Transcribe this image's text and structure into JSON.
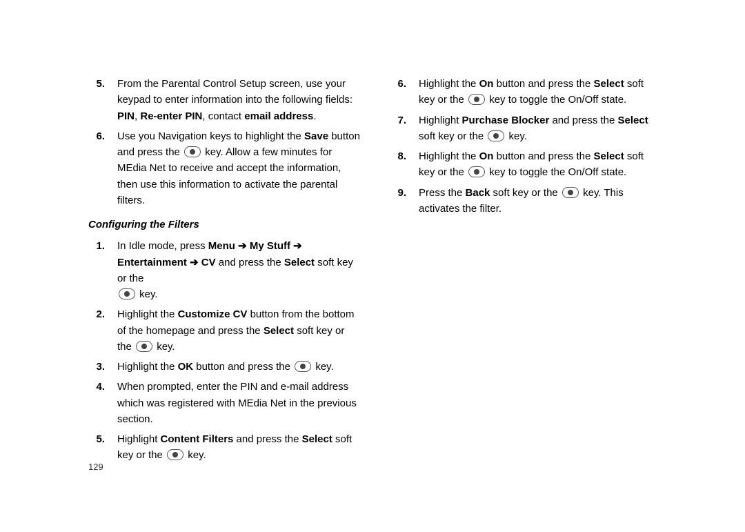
{
  "page_number": "129",
  "left": {
    "pre_items": [
      {
        "num": "5.",
        "parts": [
          {
            "t": "text",
            "v": "From the Parental Control Setup screen, use your keypad to enter information into the following fields: "
          },
          {
            "t": "bold",
            "v": "PIN"
          },
          {
            "t": "text",
            "v": ", "
          },
          {
            "t": "bold",
            "v": "Re-enter PIN"
          },
          {
            "t": "text",
            "v": ", contact "
          },
          {
            "t": "bold",
            "v": "email address"
          },
          {
            "t": "text",
            "v": "."
          }
        ]
      },
      {
        "num": "6.",
        "parts": [
          {
            "t": "text",
            "v": "Use you Navigation keys to highlight the "
          },
          {
            "t": "bold",
            "v": "Save"
          },
          {
            "t": "text",
            "v": " button and press the "
          },
          {
            "t": "key"
          },
          {
            "t": "text",
            "v": " key. Allow a few minutes for MEdia Net to receive and accept the information, then use this information to activate the parental filters."
          }
        ]
      }
    ],
    "heading": "Configuring the Filters",
    "items": [
      {
        "num": "1.",
        "parts": [
          {
            "t": "text",
            "v": "In Idle mode, press "
          },
          {
            "t": "bold",
            "v": "Menu"
          },
          {
            "t": "text",
            "v": " "
          },
          {
            "t": "arrow"
          },
          {
            "t": "text",
            "v": " "
          },
          {
            "t": "bold",
            "v": "My Stuff"
          },
          {
            "t": "text",
            "v": " "
          },
          {
            "t": "arrow"
          },
          {
            "t": "text",
            "v": " "
          },
          {
            "t": "bold",
            "v": "Entertainment"
          },
          {
            "t": "text",
            "v": " "
          },
          {
            "t": "arrow"
          },
          {
            "t": "text",
            "v": " "
          },
          {
            "t": "bold",
            "v": "CV"
          },
          {
            "t": "text",
            "v": " and press the "
          },
          {
            "t": "bold",
            "v": "Select"
          },
          {
            "t": "text",
            "v": " soft key or the "
          },
          {
            "t": "br"
          },
          {
            "t": "key"
          },
          {
            "t": "text",
            "v": " key."
          }
        ]
      },
      {
        "num": "2.",
        "parts": [
          {
            "t": "text",
            "v": "Highlight the "
          },
          {
            "t": "bold",
            "v": "Customize CV"
          },
          {
            "t": "text",
            "v": " button from the bottom of the homepage and press the "
          },
          {
            "t": "bold",
            "v": "Select"
          },
          {
            "t": "text",
            "v": " soft key or the "
          },
          {
            "t": "key"
          },
          {
            "t": "text",
            "v": " key."
          }
        ]
      },
      {
        "num": "3.",
        "parts": [
          {
            "t": "text",
            "v": "Highlight the "
          },
          {
            "t": "bold",
            "v": "OK"
          },
          {
            "t": "text",
            "v": " button and press the "
          },
          {
            "t": "key"
          },
          {
            "t": "text",
            "v": " key."
          }
        ]
      },
      {
        "num": "4.",
        "parts": [
          {
            "t": "text",
            "v": "When prompted, enter the PIN and e-mail address which was registered with MEdia Net in the previous section."
          }
        ]
      },
      {
        "num": "5.",
        "parts": [
          {
            "t": "text",
            "v": "Highlight "
          },
          {
            "t": "bold",
            "v": "Content Filters"
          },
          {
            "t": "text",
            "v": " and press the "
          },
          {
            "t": "bold",
            "v": "Select"
          },
          {
            "t": "text",
            "v": " soft key or the "
          },
          {
            "t": "key"
          },
          {
            "t": "text",
            "v": " key."
          }
        ]
      }
    ]
  },
  "right": {
    "items": [
      {
        "num": "6.",
        "parts": [
          {
            "t": "text",
            "v": "Highlight the "
          },
          {
            "t": "bold",
            "v": "On"
          },
          {
            "t": "text",
            "v": " button and press the "
          },
          {
            "t": "bold",
            "v": "Select"
          },
          {
            "t": "text",
            "v": " soft key or the "
          },
          {
            "t": "key"
          },
          {
            "t": "text",
            "v": " key to toggle the On/Off state."
          }
        ]
      },
      {
        "num": "7.",
        "parts": [
          {
            "t": "text",
            "v": "Highlight "
          },
          {
            "t": "bold",
            "v": "Purchase Blocker"
          },
          {
            "t": "text",
            "v": " and press the "
          },
          {
            "t": "bold",
            "v": "Select"
          },
          {
            "t": "text",
            "v": " soft key or the "
          },
          {
            "t": "key"
          },
          {
            "t": "text",
            "v": " key."
          }
        ]
      },
      {
        "num": "8.",
        "parts": [
          {
            "t": "text",
            "v": "Highlight the "
          },
          {
            "t": "bold",
            "v": "On"
          },
          {
            "t": "text",
            "v": " button and press the "
          },
          {
            "t": "bold",
            "v": "Select"
          },
          {
            "t": "text",
            "v": " soft key or the "
          },
          {
            "t": "key"
          },
          {
            "t": "text",
            "v": " key to toggle the On/Off state."
          }
        ]
      },
      {
        "num": "9.",
        "parts": [
          {
            "t": "text",
            "v": "Press the "
          },
          {
            "t": "bold",
            "v": "Back"
          },
          {
            "t": "text",
            "v": " soft key or the "
          },
          {
            "t": "key"
          },
          {
            "t": "text",
            "v": " key. This activates the filter."
          }
        ]
      }
    ]
  }
}
